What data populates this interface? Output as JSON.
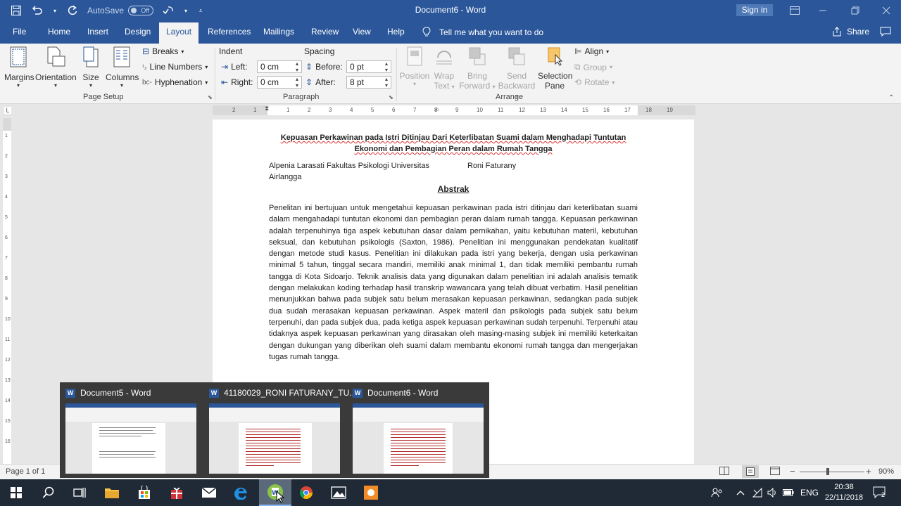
{
  "titlebar": {
    "autosave_label": "AutoSave",
    "autosave_state": "Off",
    "document_title": "Document6 - Word",
    "signin_label": "Sign in"
  },
  "tabs": [
    {
      "label": "File"
    },
    {
      "label": "Home"
    },
    {
      "label": "Insert"
    },
    {
      "label": "Design"
    },
    {
      "label": "Layout"
    },
    {
      "label": "References"
    },
    {
      "label": "Mailings"
    },
    {
      "label": "Review"
    },
    {
      "label": "View"
    },
    {
      "label": "Help"
    }
  ],
  "tell_me": "Tell me what you want to do",
  "share_label": "Share",
  "ribbon": {
    "page_setup": {
      "margins": "Margins",
      "orientation": "Orientation",
      "size": "Size",
      "columns": "Columns",
      "breaks": "Breaks",
      "line_numbers": "Line Numbers",
      "hyphenation": "Hyphenation",
      "group_label": "Page Setup"
    },
    "paragraph": {
      "indent_label": "Indent",
      "spacing_label": "Spacing",
      "left_label": "Left:",
      "left_value": "0 cm",
      "right_label": "Right:",
      "right_value": "0 cm",
      "before_label": "Before:",
      "before_value": "0 pt",
      "after_label": "After:",
      "after_value": "8 pt",
      "group_label": "Paragraph"
    },
    "arrange": {
      "position": "Position",
      "wrap_text_1": "Wrap",
      "wrap_text_2": "Text",
      "bring_forward_1": "Bring",
      "bring_forward_2": "Forward",
      "send_backward_1": "Send",
      "send_backward_2": "Backward",
      "selection_pane_1": "Selection",
      "selection_pane_2": "Pane",
      "align": "Align",
      "group": "Group",
      "rotate": "Rotate",
      "group_label": "Arrange"
    }
  },
  "ruler": {
    "left_ticks": [
      "2",
      "1"
    ],
    "right_ticks": [
      "1",
      "2",
      "3",
      "4",
      "5",
      "6",
      "7",
      "8",
      "9",
      "10",
      "11",
      "12",
      "13",
      "14",
      "15",
      "16",
      "17",
      "18",
      "19"
    ],
    "vertical_ticks": [
      "1",
      "2",
      "3",
      "4",
      "5",
      "6",
      "7",
      "8",
      "9",
      "10",
      "11",
      "12",
      "13",
      "14",
      "15",
      "16"
    ]
  },
  "document": {
    "title_line1": "Kepuasan Perkawinan pada Istri Ditinjau Dari Keterlibatan Suami dalam Menghadapi Tuntutan",
    "title_line2": "Ekonomi dan Pembagian Peran dalam Rumah Tangga",
    "author1_line1": "Alpenia Larasati Fakultas Psikologi Universitas",
    "author1_line2": "Airlangga",
    "author2": "Roni Faturany",
    "abstract_heading": "Abstrak",
    "abstract_body": "Penelitan ini bertujuan untuk mengetahui kepuasan perkawinan pada istri ditinjau dari keterlibatan suami dalam mengahadapi tuntutan ekonomi dan pembagian peran dalam rumah tangga. Kepuasan perkawinan adalah terpenuhinya tiga aspek kebutuhan dasar dalam pernikahan, yaitu kebutuhan materil, kebutuhan seksual, dan kebutuhan psikologis (Saxton, 1986). Penelitian ini menggunakan pendekatan kualitatif dengan metode studi kasus. Penelitian ini dilakukan pada istri yang bekerja, dengan usia perkawinan minimal 5 tahun, tinggal secara mandiri, memiliki anak minimal 1, dan tidak memiliki pembantu rumah tangga di Kota Sidoarjo. Teknik analisis data yang digunakan dalam penelitian ini adalah analisis tematik dengan melakukan koding terhadap hasil transkrip wawancara yang telah dibuat verbatim. Hasil penelitian menunjukkan bahwa pada subjek satu belum merasakan kepuasan perkawinan, sedangkan pada subjek dua sudah merasakan kepuasan perkawinan. Aspek materil dan psikologis pada subjek satu belum terpenuhi, dan pada subjek dua, pada ketiga aspek kepuasan perkawinan sudah terpenuhi. Terpenuhi atau tidaknya aspek kepuasan perkawinan yang dirasakan oleh masing-masing subjek ini memiliki keterkaitan dengan dukungan yang diberikan oleh suami dalam membantu ekonomi rumah tangga dan mengerjakan tugas rumah tangga."
  },
  "statusbar": {
    "page_info": "Page 1 of 1",
    "zoom": "90%"
  },
  "thumbnails": [
    {
      "title": "Document5 - Word"
    },
    {
      "title": "41180029_RONI FATURANY_TU..."
    },
    {
      "title": "Document6 - Word"
    }
  ],
  "taskbar": {
    "language": "ENG",
    "time": "20:38",
    "date": "22/11/2018",
    "notifications": "2"
  },
  "colors": {
    "word_blue": "#2b579a",
    "taskbar": "#1f2a36"
  }
}
